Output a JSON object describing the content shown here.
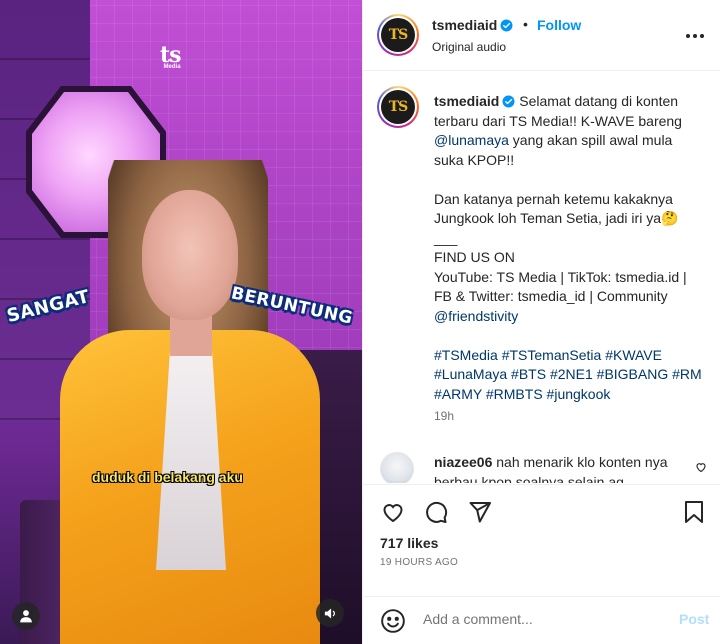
{
  "media": {
    "watermark": "ts",
    "watermark_small": "Media",
    "sticker_left": "SANGAT",
    "sticker_right": "BERUNTUNG",
    "subtitle": "duduk di belakang aku",
    "icons": {
      "user": "user-icon",
      "sound": "sound-icon"
    }
  },
  "header": {
    "username": "tsmediaid",
    "dot": "•",
    "follow_label": "Follow",
    "audio": "Original audio",
    "avatar_text": "TS",
    "icons": {
      "verified": "verified-badge-icon",
      "more": "more-options-icon"
    }
  },
  "caption": {
    "username": "tsmediaid",
    "text_1": " Selamat datang di konten terbaru dari TS Media!! K-WAVE bareng ",
    "mention_1": "@lunamaya",
    "text_2": " yang akan spill awal mula suka KPOP!!\n\nDan katanya pernah ketemu kakaknya Jungkook loh Teman Setia, jadi iri ya🤔\n___\nFIND US ON\nYouTube: TS Media | TikTok: tsmedia.id | FB & Twitter: tsmedia_id | Community ",
    "mention_2": "@friendstivity",
    "text_3": "\n\n",
    "hashtags": "#TSMedia #TSTemanSetia #KWAVE #LunaMaya #BTS #2NE1 #BIGBANG #RM #ARMY #RMBTS #jungkook",
    "time_ago": "19h"
  },
  "comment": {
    "username": "niazee06",
    "text": " nah menarik klo konten nya berbau kpop soalnya selain ag"
  },
  "actions": {
    "likes": "717 likes",
    "date": "19 HOURS AGO",
    "icons": [
      "heart-icon",
      "comment-icon",
      "share-icon",
      "bookmark-icon"
    ]
  },
  "comment_bar": {
    "placeholder": "Add a comment...",
    "post_label": "Post",
    "icon": "emoji-icon"
  },
  "colors": {
    "accent": "#0095f6",
    "link": "#00376b",
    "muted": "#737373",
    "post_disabled": "#b2dffc"
  }
}
